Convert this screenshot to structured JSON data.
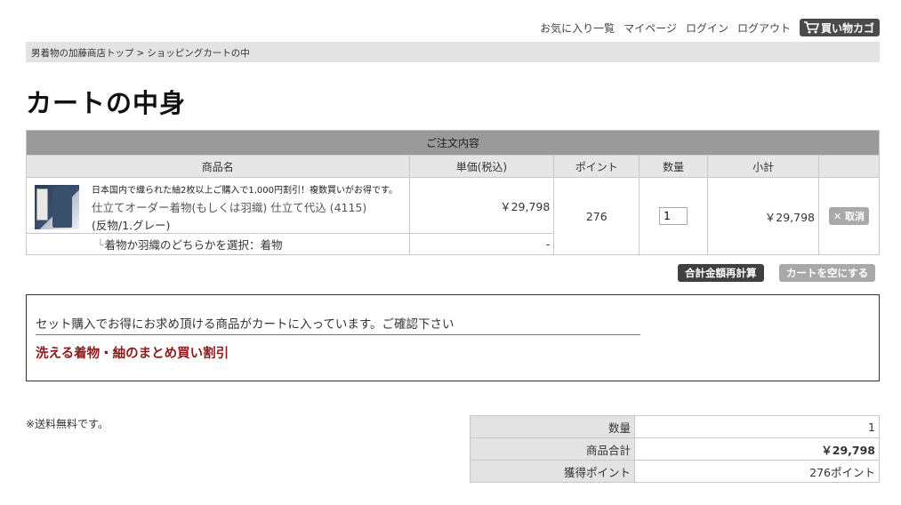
{
  "topnav": {
    "favorites": "お気に入り一覧",
    "mypage": "マイページ",
    "login": "ログイン",
    "logout": "ログアウト",
    "cart": "買い物カゴ"
  },
  "breadcrumb": {
    "home": "男着物の加藤商店トップ",
    "separator": ">",
    "current": "ショッピングカートの中"
  },
  "page_title": "カートの中身",
  "cart_table": {
    "caption": "ご注文内容",
    "headers": [
      "商品名",
      "単価(税込)",
      "ポイント",
      "数量",
      "小計",
      ""
    ],
    "item": {
      "note": "日本国内で織られた紬2枚以上ご購入で1,000円割引！複数買いがお得です。",
      "name": "仕立てオーダー着物(もしくは羽織) 仕立て代込 (4115)",
      "option": "(反物/1.グレー)",
      "unit_price": "￥29,798",
      "points": "276",
      "quantity": "1",
      "subtotal": "￥29,798",
      "cancel_label": "取消",
      "sub_option_label": "着物か羽織のどちらかを選択：着物",
      "sub_option_price": "-"
    }
  },
  "buttons": {
    "recalc": "合計金額再計算",
    "empty_cart": "カートを空にする"
  },
  "set_purchase": {
    "message": "セット購入でお得にお求め頂ける商品がカートに入っています。ご確認下さい",
    "link": "洗える着物・紬のまとめ買い割引"
  },
  "shipping_note": "※送料無料です。",
  "summary": [
    {
      "label": "数量",
      "value": "1"
    },
    {
      "label": "商品合計",
      "value": "￥29,798"
    },
    {
      "label": "獲得ポイント",
      "value": "276ポイント"
    }
  ],
  "colors": {
    "accent_link": "#8b1a1a",
    "header_bg": "#9a9a9a",
    "dark_button": "#404040"
  }
}
